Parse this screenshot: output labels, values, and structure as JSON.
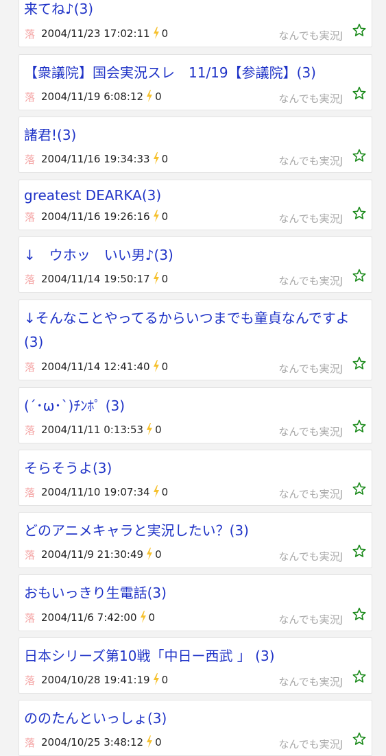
{
  "colors": {
    "title": "#1f33c7",
    "fall_icon": "#f4a3a3",
    "bolt": "#f6c12e",
    "board": "#a8a8a8",
    "star": "#1a8a1a"
  },
  "icons": {
    "fall": "落-text-icon",
    "bolt": "lightning-bolt-icon",
    "star": "star-outline-icon"
  },
  "threads": [
    {
      "title": "来てね♪(3)",
      "date": "2004/11/23 17:02:11",
      "count": "0",
      "fall": "落",
      "board": "なんでも実況J"
    },
    {
      "title": "【衆議院】国会実況スレ　11/19【参議院】(3)",
      "date": "2004/11/19 6:08:12",
      "count": "0",
      "fall": "落",
      "board": "なんでも実況J"
    },
    {
      "title": "諸君!(3)",
      "date": "2004/11/16 19:34:33",
      "count": "0",
      "fall": "落",
      "board": "なんでも実況J"
    },
    {
      "title": "greatest DEARKA(3)",
      "date": "2004/11/16 19:26:16",
      "count": "0",
      "fall": "落",
      "board": "なんでも実況J"
    },
    {
      "title": "↓　ウホッ　いい男♪(3)",
      "date": "2004/11/14 19:50:17",
      "count": "0",
      "fall": "落",
      "board": "なんでも実況J"
    },
    {
      "title": "↓そんなことやってるからいつまでも童貞なんですよ(3)",
      "date": "2004/11/14 12:41:40",
      "count": "0",
      "fall": "落",
      "board": "なんでも実況J"
    },
    {
      "title": "(´･ω･`)ﾁﾝﾎﾟ (3)",
      "date": "2004/11/11 0:13:53",
      "count": "0",
      "fall": "落",
      "board": "なんでも実況J"
    },
    {
      "title": "そらそうよ(3)",
      "date": "2004/11/10 19:07:34",
      "count": "0",
      "fall": "落",
      "board": "なんでも実況J"
    },
    {
      "title": "どのアニメキャラと実況したい？(3)",
      "date": "2004/11/9 21:30:49",
      "count": "0",
      "fall": "落",
      "board": "なんでも実況J"
    },
    {
      "title": "おもいっきり生電話(3)",
      "date": "2004/11/6 7:42:00",
      "count": "0",
      "fall": "落",
      "board": "なんでも実況J"
    },
    {
      "title": "日本シリーズ第10戦「中日ー西武 」 (3)",
      "date": "2004/10/28 19:41:19",
      "count": "0",
      "fall": "落",
      "board": "なんでも実況J"
    },
    {
      "title": "ののたんといっしょ(3)",
      "date": "2004/10/25 3:48:12",
      "count": "0",
      "fall": "落",
      "board": "なんでも実況J"
    }
  ]
}
